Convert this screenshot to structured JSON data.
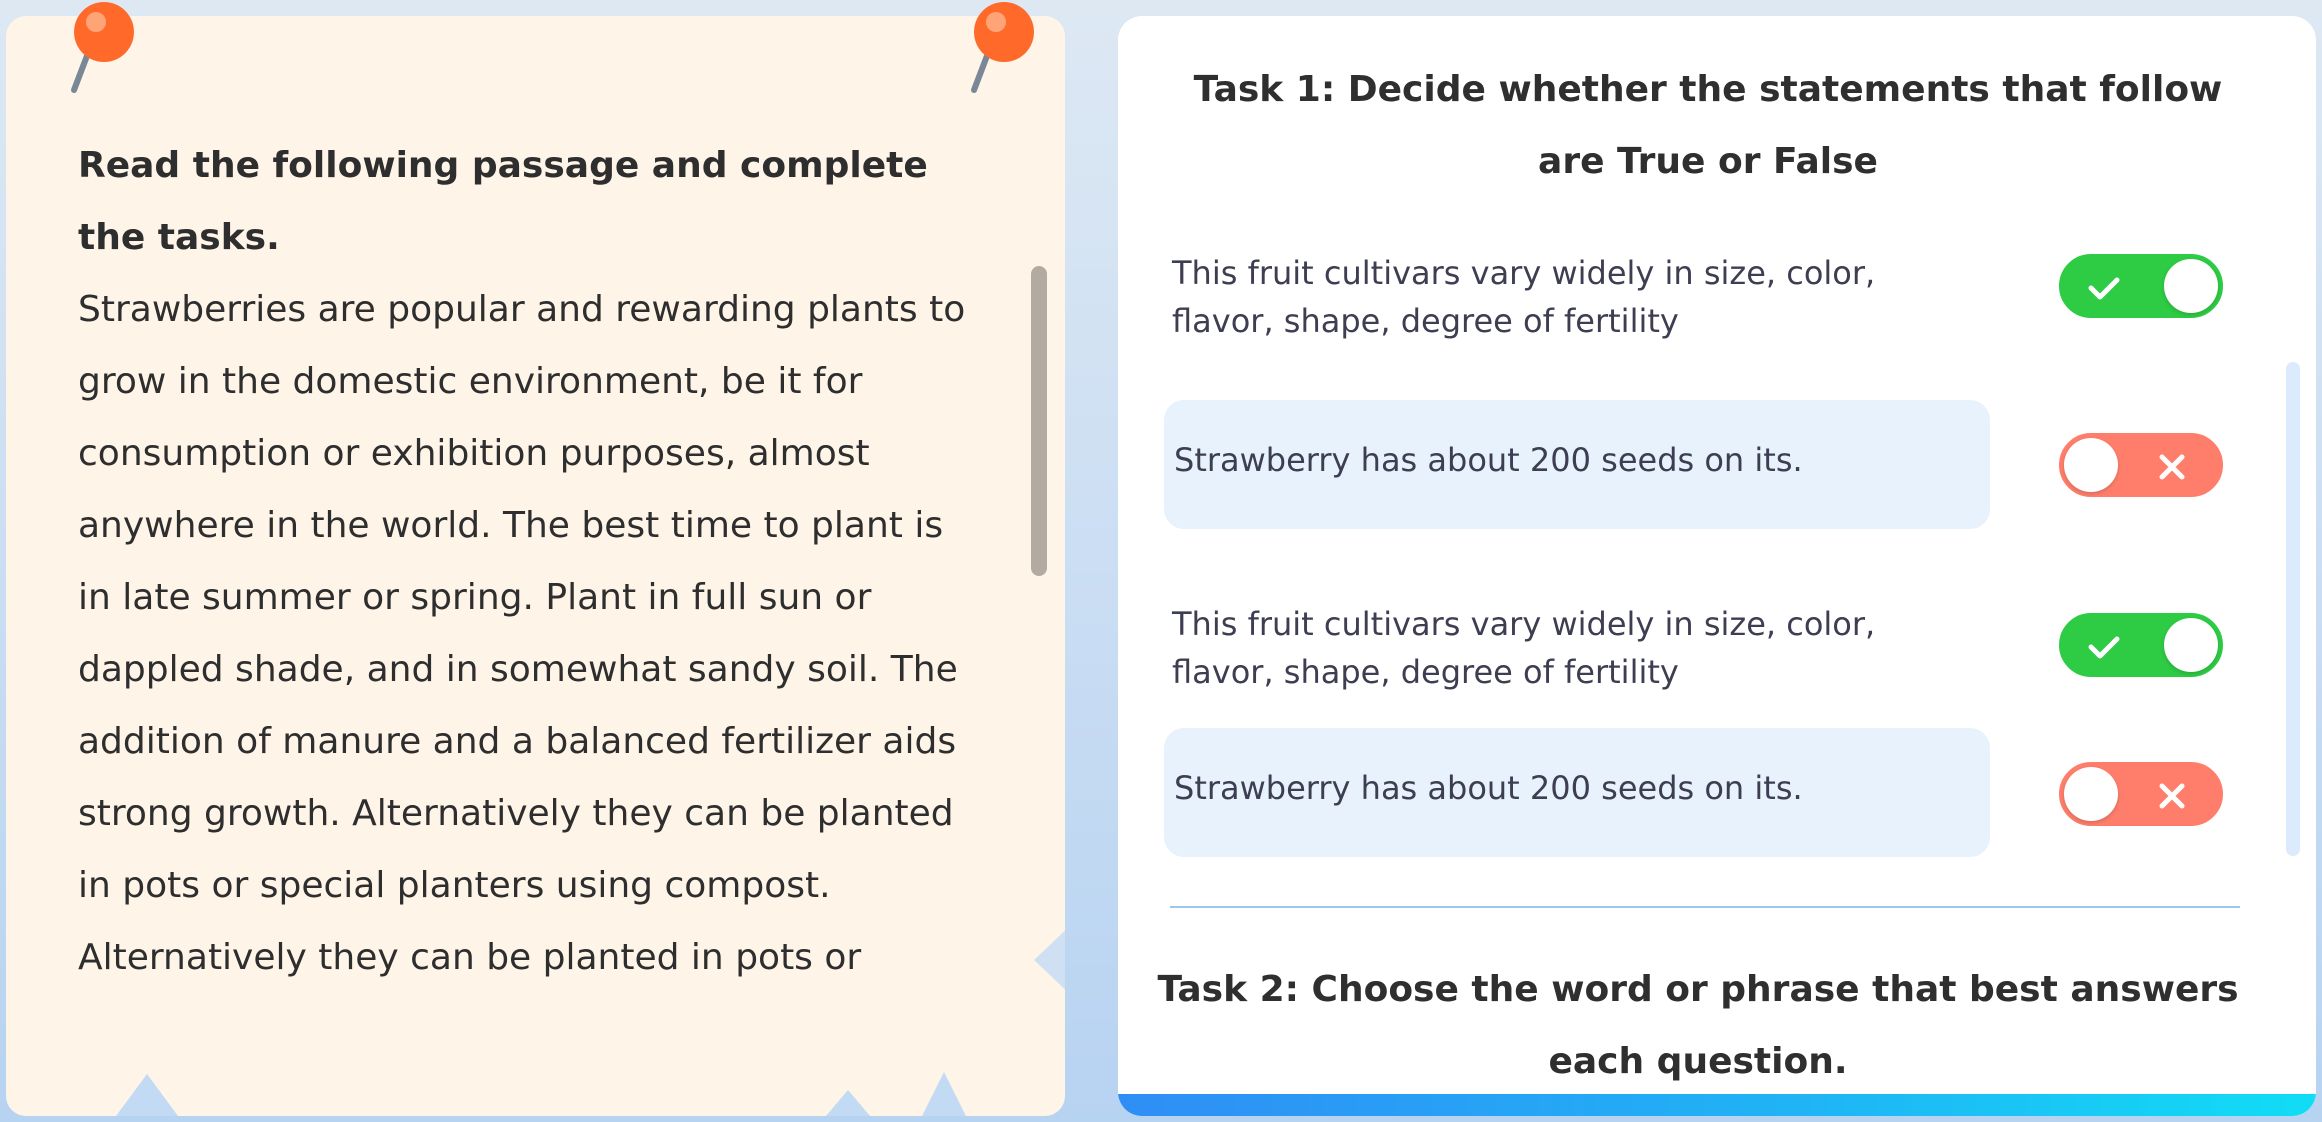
{
  "passage": {
    "heading": "Read the following passage and complete the tasks.",
    "paragraphs": [
      "Strawberries are popular and rewarding plants to grow in the domestic environment, be it for consumption or exhibition purposes, almost anywhere in the world. The best time to plant is in late summer or spring. Plant in full sun or dappled shade, and in somewhat sandy soil. The addition of manure and a balanced fertilizer aids strong growth. Alternatively they can be planted in pots or special planters using compost.",
      "Alternatively they can be planted in pots or"
    ]
  },
  "task1": {
    "title": "Task 1: Decide whether the statements that follow are True or False",
    "statements": [
      {
        "text": "This fruit cultivars vary widely in size, color, flavor, shape, degree of fertility",
        "answer": "true"
      },
      {
        "text": "Strawberry has about 200 seeds on its.",
        "answer": "false"
      },
      {
        "text": "This fruit cultivars vary widely in size, color, flavor, shape, degree of fertility",
        "answer": "true"
      },
      {
        "text": "Strawberry has about 200 seeds on its.",
        "answer": "false"
      }
    ]
  },
  "task2": {
    "title": "Task 2: Choose the word or phrase that best answers each question."
  },
  "colors": {
    "passage_bg": "#fef4e8",
    "toggle_true": "#2ecb44",
    "toggle_false": "#ff7e6b",
    "statement_highlight": "#e7f2fd",
    "pin": "#ff6a2b"
  },
  "icons": {
    "pin": "pushpin-icon",
    "true": "check-icon",
    "false": "cross-icon"
  }
}
